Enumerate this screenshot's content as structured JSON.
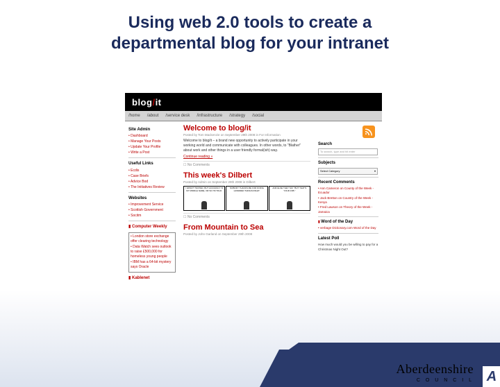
{
  "slide": {
    "title_line1": "Using web 2.0 tools to create a",
    "title_line2": "departmental blog for your intranet"
  },
  "blog": {
    "logo_text": "blog",
    "logo_slash": "/",
    "logo_it": "it",
    "nav": [
      "/home",
      "/about",
      "/service desk",
      "/infrastructure",
      "/strategy",
      "/social"
    ],
    "left": {
      "admin_heading": "Site Admin",
      "admin_items": [
        "Dashboard",
        "Manage Your Posts",
        "Update Your Profile",
        "Write a Post"
      ],
      "links_heading": "Useful Links",
      "links_items": [
        "Ecdis",
        "Case Briefs",
        "Advice Bod",
        "The Initiatives Review"
      ],
      "websites_heading": "Websites",
      "websites_items": [
        "Improvement Service",
        "Scottish Government",
        "Socitm"
      ],
      "cw_heading": "Computer Weekly",
      "cw_items": [
        "London store exchange offer clearing technology",
        "Data Watch sees outlook to raise £500,000 for homeless young people",
        "IBM has a 64-bit mystery says Oracle"
      ],
      "kb_heading": "Kablenet"
    },
    "center": {
      "post1_title": "Welcome to blog/it",
      "post1_meta": "Posted by Tom Mackenzie on September 29th 2008 in For Information",
      "post1_body": "Welcome to blog/it – a brand new opportunity to actively participate in your working world and communicate with colleagues. In other words, to \"Blather\" about work and other things in a user friendly formal(ish) way.",
      "continue": "Continue reading »",
      "no_comments": "No Comments",
      "post2_title": "This week's Dilbert",
      "post2_meta": "Posted by Admin on September 29th 2008 in Dilbert",
      "comic": [
        "I WASN'T TESTED, BUT ACCURACY IS MY MIDDLE NAME, OR SO I'M TOLD.",
        "NOBODY THANKS ME FOR DOING HUNDRED THINGS RIGHT.",
        "AND ELSE THEY SAY \"BUT THAT'S YOUR JOB.\""
      ],
      "post3_title": "From Mountain to Sea",
      "post3_meta": "Posted by John Garland on September 29th 2008"
    },
    "right": {
      "search_heading": "Search",
      "search_placeholder": "To search, type and hit enter",
      "subjects_heading": "Subjects",
      "subjects_value": "Select Category",
      "recent_heading": "Recent Comments",
      "recent_items": [
        "Ann Cameron on County of the Week - Ecuador",
        "Jack Bretton on Country of the Week - Kenya",
        "Fred Lawson on Theory of the Week - Jamaica"
      ],
      "word_heading": "Word of the Day",
      "word_items": [
        "verbage Dictionary.com Word of the Day"
      ],
      "poll_heading": "Latest Poll",
      "poll_text": "How much would you be willing to pay for a Christmas Night Out?"
    }
  },
  "brand": {
    "name": "Aberdeenshire",
    "sub": "C O U N C I L",
    "logo_letter": "A"
  }
}
